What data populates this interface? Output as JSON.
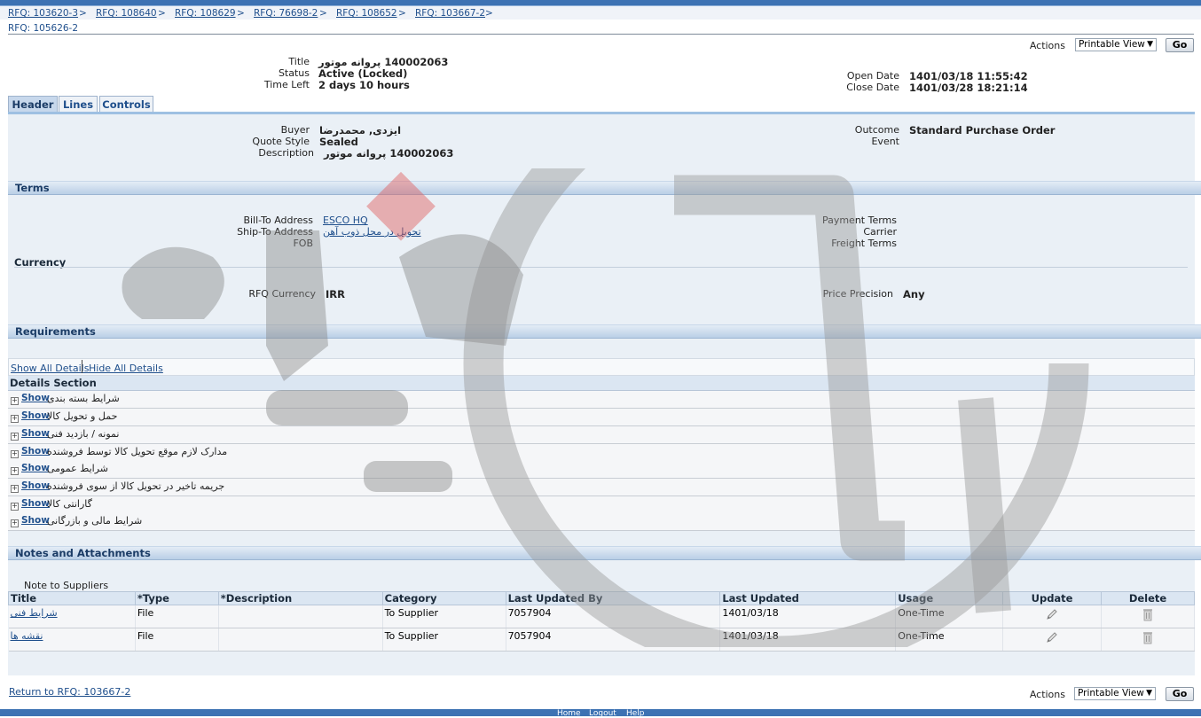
{
  "breadcrumbs": [
    "RFQ: 103620-3",
    "RFQ: 108640",
    "RFQ: 108629",
    "RFQ: 76698-2",
    "RFQ: 108652",
    "RFQ: 103667-2"
  ],
  "breadcrumb_sep": ">",
  "current_page": "RFQ: 105626-2",
  "actions": {
    "label": "Actions",
    "selected": "Printable View",
    "go": "Go"
  },
  "summary": {
    "title_label": "Title",
    "title": "140002063 پروانه موتور",
    "status_label": "Status",
    "status": "Active (Locked)",
    "time_left_label": "Time Left",
    "time_left": "2 days 10 hours",
    "open_date_label": "Open Date",
    "open_date": "1401/03/18 11:55:42",
    "close_date_label": "Close Date",
    "close_date": "1401/03/28 18:21:14"
  },
  "tabs": [
    "Header",
    "Lines",
    "Controls"
  ],
  "header": {
    "buyer_label": "Buyer",
    "buyer": "ایزدی, محمدرضا",
    "quote_style_label": "Quote Style",
    "quote_style": "Sealed",
    "description_label": "Description",
    "description": "140002063 پروانه موتور",
    "outcome_label": "Outcome",
    "outcome": "Standard Purchase Order",
    "event_label": "Event"
  },
  "terms": {
    "heading": "Terms",
    "bill_to_label": "Bill-To Address",
    "bill_to": "ESCO HQ",
    "ship_to_label": "Ship-To Address",
    "ship_to": "تحویل در محل ذوب آهن",
    "fob_label": "FOB",
    "payment_terms_label": "Payment Terms",
    "carrier_label": "Carrier",
    "freight_terms_label": "Freight Terms",
    "currency_heading": "Currency",
    "rfq_currency_label": "RFQ Currency",
    "rfq_currency": "IRR",
    "price_precision_label": "Price Precision",
    "price_precision": "Any"
  },
  "requirements": {
    "heading": "Requirements",
    "show_all": "Show All Details",
    "hide_all": "Hide All Details",
    "details_heading": "Details Section",
    "show_label": "Show",
    "sections": [
      "شرایط بسته بندی",
      "حمل و تحویل کالا",
      "نمونه / بازدید فنی",
      "مدارک لازم موقع تحویل کالا توسط فروشنده",
      "شرایط عمومی",
      "جریمه تاخیر در تحویل کالا از سوی فروشنده",
      "گارانتی کالا",
      "شرایط مالی و بازرگانی"
    ]
  },
  "notes": {
    "heading": "Notes and Attachments",
    "note_label": "Note to Suppliers",
    "columns": [
      "Title",
      "*Type",
      "*Description",
      "Category",
      "Last Updated By",
      "Last Updated",
      "Usage",
      "Update",
      "Delete"
    ],
    "rows": [
      {
        "title": "شرایط فنی",
        "type": "File",
        "description": "",
        "category": "To Supplier",
        "updated_by": "7057904",
        "updated": "1401/03/18",
        "usage": "One-Time"
      },
      {
        "title": "نقشه ها",
        "type": "File",
        "description": "",
        "category": "To Supplier",
        "updated_by": "7057904",
        "updated": "1401/03/18",
        "usage": "One-Time"
      }
    ]
  },
  "return_link": "Return to RFQ: 103667-2",
  "footer_links": [
    "Home",
    "Logout",
    "Help"
  ],
  "colors": {
    "brand_blue": "#3d72b3",
    "link": "#1f4f8c",
    "section_band": "#b9cfe6"
  },
  "icons": [
    "pencil-icon",
    "trash-icon",
    "plus-toggle-icon",
    "dropdown-arrow-icon"
  ]
}
